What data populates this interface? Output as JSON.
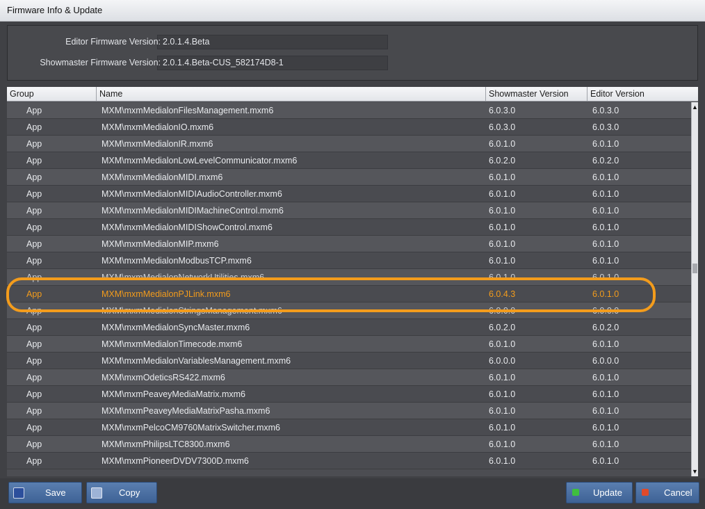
{
  "window": {
    "title": "Firmware Info & Update"
  },
  "info": {
    "editor_label": "Editor Firmware Version:",
    "editor_value": "2.0.1.4.Beta",
    "showmaster_label": "Showmaster Firmware Version:",
    "showmaster_value": "2.0.1.4.Beta-CUS_582174D8-1"
  },
  "table": {
    "columns": [
      "Group",
      "Name",
      "Showmaster Version",
      "Editor Version"
    ],
    "rows": [
      {
        "group": "App",
        "name": "MXM\\mxmMedialonFilesManagement.mxm6",
        "showmaster": "6.0.3.0",
        "editor": "6.0.3.0"
      },
      {
        "group": "App",
        "name": "MXM\\mxmMedialonIO.mxm6",
        "showmaster": "6.0.3.0",
        "editor": "6.0.3.0"
      },
      {
        "group": "App",
        "name": "MXM\\mxmMedialonIR.mxm6",
        "showmaster": "6.0.1.0",
        "editor": "6.0.1.0"
      },
      {
        "group": "App",
        "name": "MXM\\mxmMedialonLowLevelCommunicator.mxm6",
        "showmaster": "6.0.2.0",
        "editor": "6.0.2.0"
      },
      {
        "group": "App",
        "name": "MXM\\mxmMedialonMIDI.mxm6",
        "showmaster": "6.0.1.0",
        "editor": "6.0.1.0"
      },
      {
        "group": "App",
        "name": "MXM\\mxmMedialonMIDIAudioController.mxm6",
        "showmaster": "6.0.1.0",
        "editor": "6.0.1.0"
      },
      {
        "group": "App",
        "name": "MXM\\mxmMedialonMIDIMachineControl.mxm6",
        "showmaster": "6.0.1.0",
        "editor": "6.0.1.0"
      },
      {
        "group": "App",
        "name": "MXM\\mxmMedialonMIDIShowControl.mxm6",
        "showmaster": "6.0.1.0",
        "editor": "6.0.1.0"
      },
      {
        "group": "App",
        "name": "MXM\\mxmMedialonMIP.mxm6",
        "showmaster": "6.0.1.0",
        "editor": "6.0.1.0"
      },
      {
        "group": "App",
        "name": "MXM\\mxmMedialonModbusTCP.mxm6",
        "showmaster": "6.0.1.0",
        "editor": "6.0.1.0"
      },
      {
        "group": "App",
        "name": "MXM\\mxmMedialonNetworkUtilities.mxm6",
        "showmaster": "6.0.1.0",
        "editor": "6.0.1.0"
      },
      {
        "group": "App",
        "name": "MXM\\mxmMedialonPJLink.mxm6",
        "showmaster": "6.0.4.3",
        "editor": "6.0.1.0"
      },
      {
        "group": "App",
        "name": "MXM\\mxmMedialonStringsManagement.mxm6",
        "showmaster": "6.0.0.0",
        "editor": "6.0.0.0"
      },
      {
        "group": "App",
        "name": "MXM\\mxmMedialonSyncMaster.mxm6",
        "showmaster": "6.0.2.0",
        "editor": "6.0.2.0"
      },
      {
        "group": "App",
        "name": "MXM\\mxmMedialonTimecode.mxm6",
        "showmaster": "6.0.1.0",
        "editor": "6.0.1.0"
      },
      {
        "group": "App",
        "name": "MXM\\mxmMedialonVariablesManagement.mxm6",
        "showmaster": "6.0.0.0",
        "editor": "6.0.0.0"
      },
      {
        "group": "App",
        "name": "MXM\\mxmOdeticsRS422.mxm6",
        "showmaster": "6.0.1.0",
        "editor": "6.0.1.0"
      },
      {
        "group": "App",
        "name": "MXM\\mxmPeaveyMediaMatrix.mxm6",
        "showmaster": "6.0.1.0",
        "editor": "6.0.1.0"
      },
      {
        "group": "App",
        "name": "MXM\\mxmPeaveyMediaMatrixPasha.mxm6",
        "showmaster": "6.0.1.0",
        "editor": "6.0.1.0"
      },
      {
        "group": "App",
        "name": "MXM\\mxmPelcoCM9760MatrixSwitcher.mxm6",
        "showmaster": "6.0.1.0",
        "editor": "6.0.1.0"
      },
      {
        "group": "App",
        "name": "MXM\\mxmPhilipsLTC8300.mxm6",
        "showmaster": "6.0.1.0",
        "editor": "6.0.1.0"
      },
      {
        "group": "App",
        "name": "MXM\\mxmPioneerDVDV7300D.mxm6",
        "showmaster": "6.0.1.0",
        "editor": "6.0.1.0"
      }
    ],
    "highlight_row_index": 11
  },
  "footer": {
    "save": "Save",
    "copy": "Copy",
    "update": "Update",
    "cancel": "Cancel"
  },
  "colors": {
    "highlight": "#f39c1c",
    "button": "#4a70a4"
  }
}
